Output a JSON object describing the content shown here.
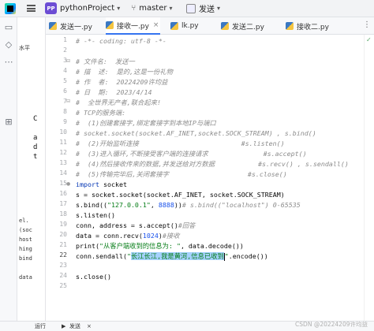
{
  "titlebar": {
    "project_badge": "PP",
    "project_name": "pythonProject",
    "branch": "master",
    "run_config": "发送"
  },
  "tabs": [
    {
      "label": "发送一.py"
    },
    {
      "label": "接收一.py"
    },
    {
      "label": "lk.py"
    },
    {
      "label": "发送二.py"
    },
    {
      "label": "接收二.py"
    }
  ],
  "active_tab": 1,
  "sidepanel": {
    "rows": [
      "水平",
      "el.",
      "(soc",
      "host",
      "hing",
      "bind",
      "data"
    ],
    "letters": [
      "C",
      "a",
      "d",
      "t"
    ]
  },
  "code": {
    "line_numbers": [
      "1",
      "2",
      "3",
      "4",
      "5",
      "6",
      "7",
      "8",
      "9",
      "10",
      "11",
      "12",
      "13",
      "14",
      "15",
      "16",
      "17",
      "18",
      "19",
      "20",
      "21",
      "22",
      "23",
      "24",
      "25"
    ],
    "current_line": "22",
    "l1": "# -*- coding: utf-8 -*-",
    "l3": "# 文件名:  发送一",
    "l4": "# 描  述:  是的,这是一份礼物",
    "l5": "# 作  者:  20224209许均益",
    "l6": "# 日  期:  2023/4/14",
    "l7": "#  全世界无产者,联合起来!",
    "l8": "# TCP的服务端:",
    "l9": "#  (1)创建套接字,绑定套接字到本地IP与端口",
    "l10a": "# socket.socket(socket.AF_INET,socket.SOCK_STREAM) , s.bind()",
    "l11": "#  (2)开始监听连接                          #s.listen()",
    "l12": "#  (3)进入循环,不断接受客户端的连接请求              #s.accept()",
    "l13": "#  (4)然后接收传来的数据,并发送给对方数据           #s.recv() , s.sendall()",
    "l14": "#  (5)传输完毕后,关闭套接字                    #s.close()",
    "import_kw": "import",
    "import_mod": " socket",
    "l16": "s = socket.socket(socket.AF_INET, socket.SOCK_STREAM)",
    "l17a": "s.bind((",
    "l17b": "\"127.0.0.1\"",
    "l17c": ", ",
    "l17d": "8888",
    "l17e": "))",
    "l17f": "# s.bind((\"localhost\") 0-65535",
    "l18": "s.listen()",
    "l19a": "conn, address = s.accept()",
    "l19b": "#回答",
    "l20a": "data = conn.recv(",
    "l20b": "1024",
    "l20c": ")",
    "l20d": "#接收",
    "l21a": "print(",
    "l21b": "\"从客户端收到的信息为: \"",
    "l21c": ", data.decode())",
    "l22a": "conn.sendall(",
    "l22b": "\"",
    "l22c": "长江长江,我是黄河,信息已收到",
    "l22d": "\"",
    "l22e": ".encode())",
    "l24": "s.close()"
  },
  "bottom": {
    "item1": "运行",
    "item2": "发送",
    "watermark": "CSDN @20224209许均益"
  }
}
